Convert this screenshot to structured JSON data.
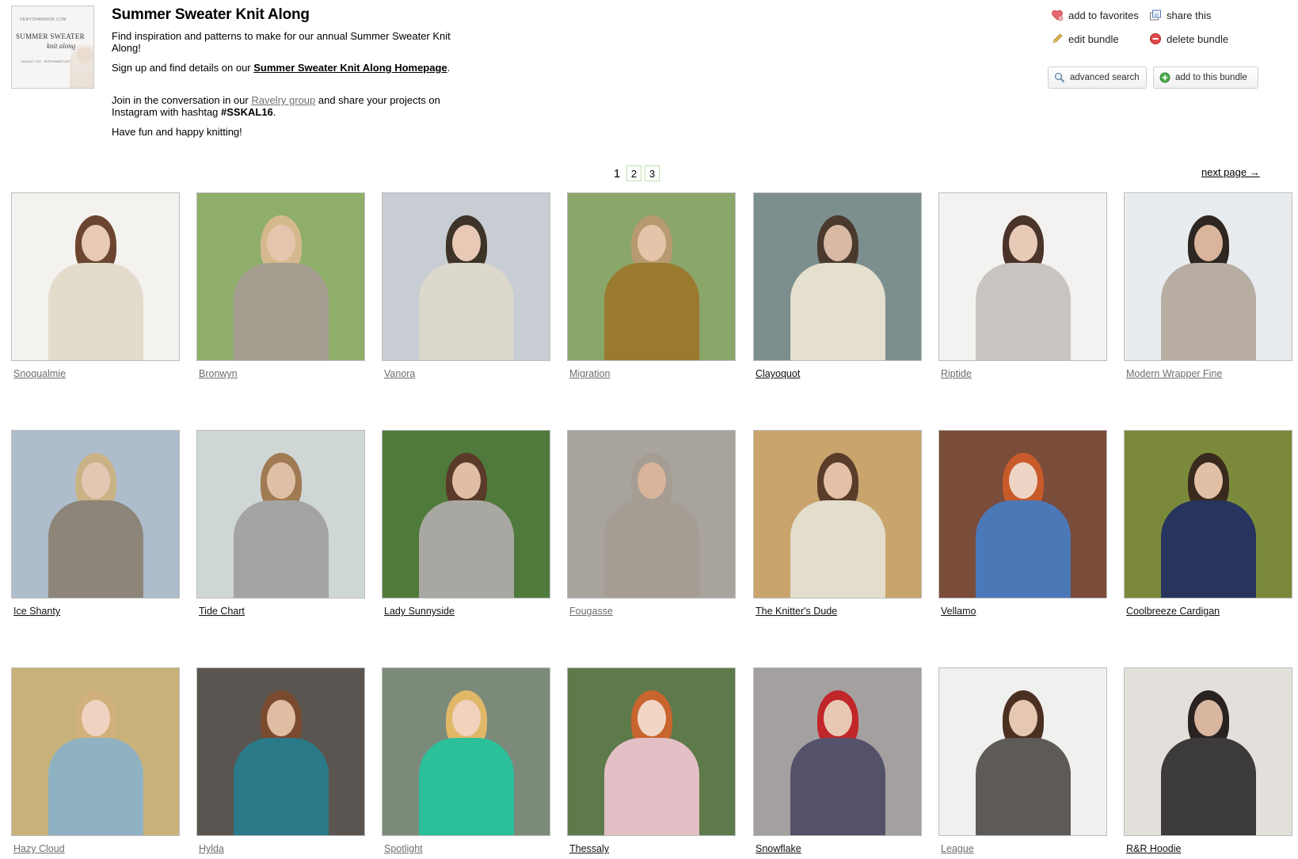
{
  "bundle": {
    "thumbnail_text": {
      "line1": "VERYSHANNON.COM",
      "line2": "SUMMER SWEATER",
      "line3": "knit along",
      "line4": "AUGUST 1ST - SEPTEMBER 30TH"
    },
    "title": "Summer Sweater Knit Along",
    "p1": "Find inspiration and patterns to make for our annual Summer Sweater Knit Along!",
    "p2_prefix": "Sign up and find details on our ",
    "p2_link": "Summer Sweater Knit Along Homepage",
    "p2_suffix": ".",
    "p3_prefix": "Join in the conversation in our ",
    "p3_link": "Ravelry group",
    "p3_mid": " and share your projects on Instagram with hashtag ",
    "p3_tag": "#SSKAL16",
    "p3_suffix": ".",
    "p4": "Have fun and happy knitting!"
  },
  "actions": {
    "add_to_favorites": "add to favorites",
    "share_this": "share this",
    "edit_bundle": "edit bundle",
    "delete_bundle": "delete bundle",
    "advanced_search": "advanced search",
    "add_to_this_bundle": "add to this bundle"
  },
  "pagination": {
    "current": "1",
    "pages": [
      "2",
      "3"
    ],
    "next": "next page →"
  },
  "colors": {
    "link_grey": "#6e6e6e",
    "pager_border": "#bfe0b0",
    "favorite_icon": "#e8686f",
    "delete_icon": "#e04848",
    "add_icon": "#4caf50"
  },
  "patterns": [
    {
      "name": "Snoqualmie",
      "link_state": "visited",
      "bg": "#f4f2ef",
      "top": "#e3dbcb",
      "skin": "#e8c9b4",
      "hair": "#6b4530"
    },
    {
      "name": "Bronwyn",
      "link_state": "visited",
      "bg": "#8fae6a",
      "top": "#a59c90",
      "skin": "#e6c4ad",
      "hair": "#d5b98e"
    },
    {
      "name": "Vanora",
      "link_state": "visited",
      "bg": "#c7cdd2",
      "top": "#ddd8cd",
      "skin": "#e7c9b5",
      "hair": "#3e3328"
    },
    {
      "name": "Migration",
      "link_state": "visited",
      "bg": "#8aa66a",
      "top": "#9a7a2e",
      "skin": "#e5c4a9",
      "hair": "#b89a70"
    },
    {
      "name": "Clayoquot",
      "link_state": "unvisited",
      "bg": "#7c8e8d",
      "top": "#e4dfce",
      "skin": "#d8b9a3",
      "hair": "#4a3a2e"
    },
    {
      "name": "Riptide",
      "link_state": "visited",
      "bg": "#f3f2f0",
      "top": "#c9c5c0",
      "skin": "#e8cbb6",
      "hair": "#4a3328"
    },
    {
      "name": "Modern Wrapper Fine",
      "link_state": "visited",
      "bg": "#e9ecee",
      "top": "#b8ada3",
      "skin": "#d9b59c",
      "hair": "#2e2620"
    },
    {
      "name": "Ice Shanty",
      "link_state": "unvisited",
      "bg": "#aebdcc",
      "top": "#8d8579",
      "skin": "#e4c7b3",
      "hair": "#c9b386"
    },
    {
      "name": "Tide Chart",
      "link_state": "unvisited",
      "bg": "#cfd6d6",
      "top": "#a4a4a2",
      "skin": "#e0bfa7",
      "hair": "#a07a52"
    },
    {
      "name": "Lady Sunnyside",
      "link_state": "unvisited",
      "bg": "#4f7a3c",
      "top": "#a9a7a2",
      "skin": "#e1bda5",
      "hair": "#5a3a28"
    },
    {
      "name": "Fougasse",
      "link_state": "visited",
      "bg": "#a8a39c",
      "top": "#a59d94",
      "skin": "#d9b49a",
      "hair": "#a59d94"
    },
    {
      "name": "The Knitter's Dude",
      "link_state": "unvisited",
      "bg": "#c9a46c",
      "top": "#e3ddcc",
      "skin": "#e3c0a6",
      "hair": "#5a3c2a"
    },
    {
      "name": "Vellamo",
      "link_state": "unvisited",
      "bg": "#7a4c3a",
      "top": "#4b79b8",
      "skin": "#eed4c4",
      "hair": "#c85a2a"
    },
    {
      "name": "Coolbreeze Cardigan",
      "link_state": "unvisited",
      "bg": "#7a8a3a",
      "top": "#26345e",
      "skin": "#e2c0a5",
      "hair": "#3a2a1e"
    },
    {
      "name": "Hazy Cloud",
      "link_state": "visited",
      "bg": "#c9b27a",
      "top": "#8eb2c2",
      "skin": "#efd3c0",
      "hair": "#d2b07c"
    },
    {
      "name": "Hylda",
      "link_state": "visited",
      "bg": "#5a5550",
      "top": "#2a7a8a",
      "skin": "#e0bca2",
      "hair": "#7a4a2e"
    },
    {
      "name": "Spotlight",
      "link_state": "visited",
      "bg": "#7c8a7a",
      "top": "#2bbf9a",
      "skin": "#f0d2bd",
      "hair": "#e0b868"
    },
    {
      "name": "Thessaly",
      "link_state": "unvisited",
      "bg": "#5e7a4a",
      "top": "#e3bfc6",
      "skin": "#f1d6c6",
      "hair": "#c8642e"
    },
    {
      "name": "Snowflake",
      "link_state": "unvisited",
      "bg": "#a4a0a0",
      "top": "#54526a",
      "skin": "#e8c8b4",
      "hair": "#c0262a"
    },
    {
      "name": "League",
      "link_state": "visited",
      "bg": "#f0f0ef",
      "top": "#5e5a58",
      "skin": "#e6c7b2",
      "hair": "#4a3020"
    },
    {
      "name": "R&R Hoodie",
      "link_state": "unvisited",
      "bg": "#e3e0db",
      "top": "#3c3a3a",
      "skin": "#d8b6a0",
      "hair": "#2a2220"
    }
  ]
}
